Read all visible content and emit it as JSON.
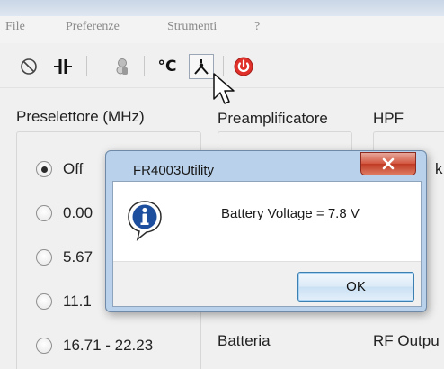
{
  "menubar": {
    "items": [
      {
        "label": "File"
      },
      {
        "label": "Preferenze"
      },
      {
        "label": "Strumenti"
      },
      {
        "label": "?"
      }
    ]
  },
  "toolbar": {
    "buttons": [
      {
        "icon": "power-off-icon"
      },
      {
        "icon": "capacitor-icon"
      },
      {
        "icon": "dial-icon"
      },
      {
        "icon": "celsius-icon",
        "label": "°C"
      },
      {
        "icon": "antenna-icon",
        "active": true
      },
      {
        "icon": "power-button-red-icon",
        "color": "#e0302a"
      }
    ]
  },
  "sections": {
    "preselector": {
      "title": "Preselettore (MHz)",
      "options": [
        {
          "label": "Off",
          "checked": true
        },
        {
          "label": "0.00"
        },
        {
          "label": "5.67"
        },
        {
          "label": "11.1"
        },
        {
          "label": "16.71 - 22.23"
        }
      ]
    },
    "preamp": {
      "title": "Preamplificatore"
    },
    "hpf": {
      "title": "HPF",
      "partial_value": "k"
    },
    "battery": {
      "title": "Batteria"
    },
    "rf_output": {
      "title": "RF Outpu"
    }
  },
  "dialog": {
    "title": "FR4003Utility",
    "message": "Battery Voltage = 7.8 V",
    "ok_label": "OK",
    "close_label": "x",
    "icon": "information-icon"
  },
  "colors": {
    "title_bar": "#b9d1ea",
    "close_button": "#c03a23",
    "ok_button_border": "#3c7fb1",
    "info_icon": "#1e4f9e",
    "menu_text": "#8a8a8a"
  }
}
